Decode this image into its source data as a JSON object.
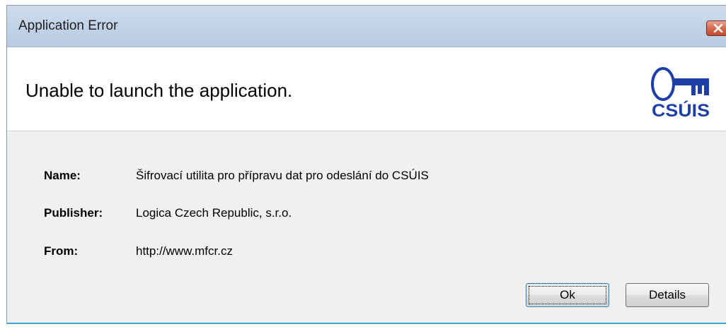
{
  "window": {
    "title": "Application Error"
  },
  "header": {
    "message": "Unable to launch the application.",
    "logo_text": "CSÚIS"
  },
  "details": [
    {
      "label": "Name:",
      "value": "Šifrovací utilita pro přípravu dat pro odeslání do CSÚIS"
    },
    {
      "label": "Publisher:",
      "value": "Logica Czech Republic, s.r.o."
    },
    {
      "label": "From:",
      "value": "http://www.mfcr.cz"
    }
  ],
  "buttons": {
    "ok_label": "Ok",
    "details_label": "Details"
  },
  "icons": {
    "close": "close-icon",
    "logo": "key-logo-icon"
  },
  "colors": {
    "titlebar": "#c3d4e7",
    "close_button": "#d46a4e",
    "logo_blue": "#1f3fa8",
    "accent_line": "#3ea6d6"
  }
}
